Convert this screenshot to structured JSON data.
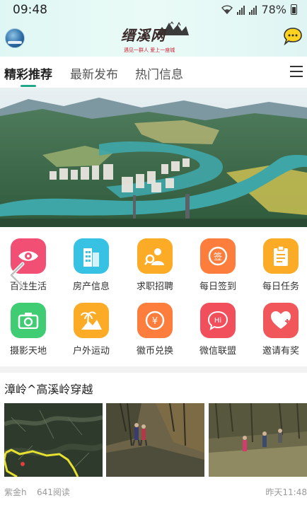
{
  "status": {
    "time": "09:48",
    "battery": "78%"
  },
  "header": {
    "logo_text": "缙溪网",
    "logo_sub": "遇见一群人 爱上一座城"
  },
  "tabs": [
    {
      "label": "精彩推荐"
    },
    {
      "label": "最新发布"
    },
    {
      "label": "热门信息"
    }
  ],
  "grid": [
    {
      "label": "百姓生活",
      "icon": "eye-icon",
      "color": "#f14f74"
    },
    {
      "label": "房产信息",
      "icon": "building-icon",
      "color": "#37c1e3"
    },
    {
      "label": "求职招聘",
      "icon": "job-search-icon",
      "color": "#fbab25"
    },
    {
      "label": "每日签到",
      "icon": "sign-in-icon",
      "color": "#fd7d3c"
    },
    {
      "label": "每日任务",
      "icon": "task-clipboard-icon",
      "color": "#fbab25"
    },
    {
      "label": "摄影天地",
      "icon": "camera-icon",
      "color": "#3fcc72"
    },
    {
      "label": "户外运动",
      "icon": "outdoor-palm-icon",
      "color": "#fbab25"
    },
    {
      "label": "徽币兑换",
      "icon": "coin-exchange-icon",
      "color": "#fd7d3c"
    },
    {
      "label": "微信联盟",
      "icon": "wechat-hi-icon",
      "color": "#f14f5c"
    },
    {
      "label": "邀请有奖",
      "icon": "invite-heart-icon",
      "color": "#f1565a"
    }
  ],
  "article": {
    "title": "漳岭^高溪岭穿越",
    "author": "紫金h",
    "reads": "641阅读",
    "time": "昨天11:48"
  },
  "colors": {
    "accent": "#21a88a"
  }
}
